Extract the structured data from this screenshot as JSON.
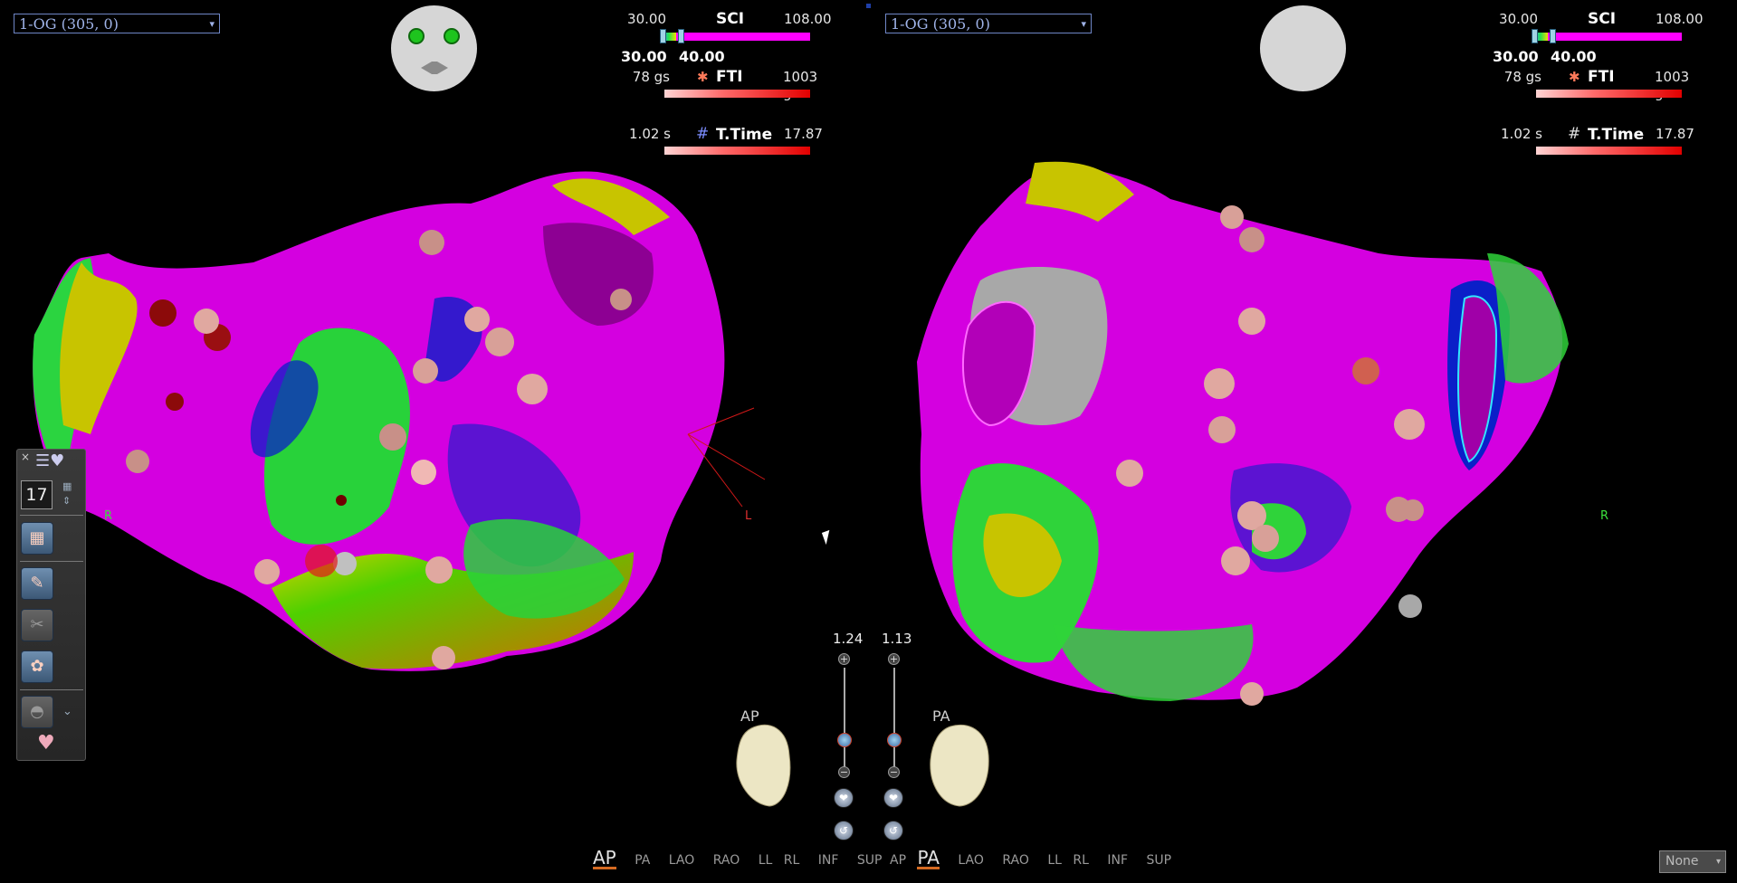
{
  "left_pane": {
    "map_select": "1-OG (305, 0)",
    "legends": {
      "sci": {
        "name": "SCI",
        "min": "30.00",
        "max": "108.00",
        "lower_value": "30.00",
        "upper_value": "40.00"
      },
      "fti": {
        "name": "FTI",
        "min": "78 gs",
        "max": "1003 gs"
      },
      "ttime": {
        "name": "T.Time",
        "min": "1.02 s",
        "max": "17.87 s"
      }
    },
    "axis_right": "R",
    "axis_left": "L"
  },
  "right_pane": {
    "map_select": "1-OG (305, 0)",
    "legends": {
      "sci": {
        "name": "SCI",
        "min": "30.00",
        "max": "108.00",
        "lower_value": "30.00",
        "upper_value": "40.00"
      },
      "fti": {
        "name": "FTI",
        "min": "78 gs",
        "max": "1003 gs"
      },
      "ttime": {
        "name": "T.Time",
        "min": "1.02 s",
        "max": "17.87 s"
      }
    },
    "axis_right": "R"
  },
  "toolbar": {
    "count": "17",
    "close": "×"
  },
  "zoom": {
    "left": "1.24",
    "right": "1.13"
  },
  "orientation": {
    "left_label": "AP",
    "right_label": "PA"
  },
  "views_left": [
    "AP",
    "PA",
    "LAO",
    "RAO",
    "LL",
    "RL",
    "INF",
    "SUP"
  ],
  "views_right": [
    "AP",
    "PA",
    "LAO",
    "RAO",
    "LL",
    "RL",
    "INF",
    "SUP"
  ],
  "active_left": "AP",
  "active_right": "PA",
  "none_select": "None",
  "colors": {
    "accent": "#d56a22",
    "sci_bar": "#ff00ff",
    "map_magenta": "#d400e0",
    "map_green": "#26d12a",
    "map_blue": "#0b1fc8"
  },
  "icons": [
    "heart-list-icon",
    "grid-icon",
    "catheter-icon",
    "scissors-icon",
    "tag-icon",
    "anatomy-icon",
    "heart-icon",
    "zoom-in-icon",
    "zoom-out-icon",
    "reset-icon"
  ]
}
